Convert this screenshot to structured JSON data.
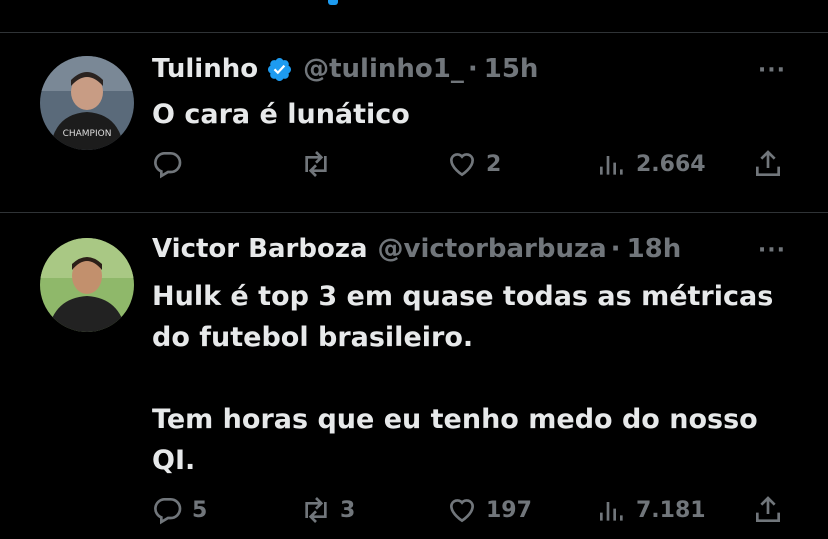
{
  "tweets": [
    {
      "name": "Tulinho",
      "verified": true,
      "handle": "@tulinho1_",
      "separator": "·",
      "time": "15h",
      "text": "O cara é lunático",
      "replies": "",
      "retweets": "",
      "likes": "2",
      "views": "2.664"
    },
    {
      "name": "Victor Barboza",
      "verified": false,
      "handle": "@victorbarbuza",
      "separator": "·",
      "time": "18h",
      "text": "Hulk é top 3 em quase todas as métricas\ndo futebol brasileiro.\n\nTem horas que eu tenho medo do nosso\nQI.",
      "replies": "5",
      "retweets": "3",
      "likes": "197",
      "views": "7.181"
    }
  ],
  "more_label": "···",
  "colors": {
    "accent": "#1d9bf0",
    "muted": "#71767b",
    "text": "#e7e9ea",
    "divider": "#2f3336"
  },
  "icons": [
    "verified-badge-icon",
    "reply-icon",
    "retweet-icon",
    "like-icon",
    "views-icon",
    "share-icon"
  ]
}
